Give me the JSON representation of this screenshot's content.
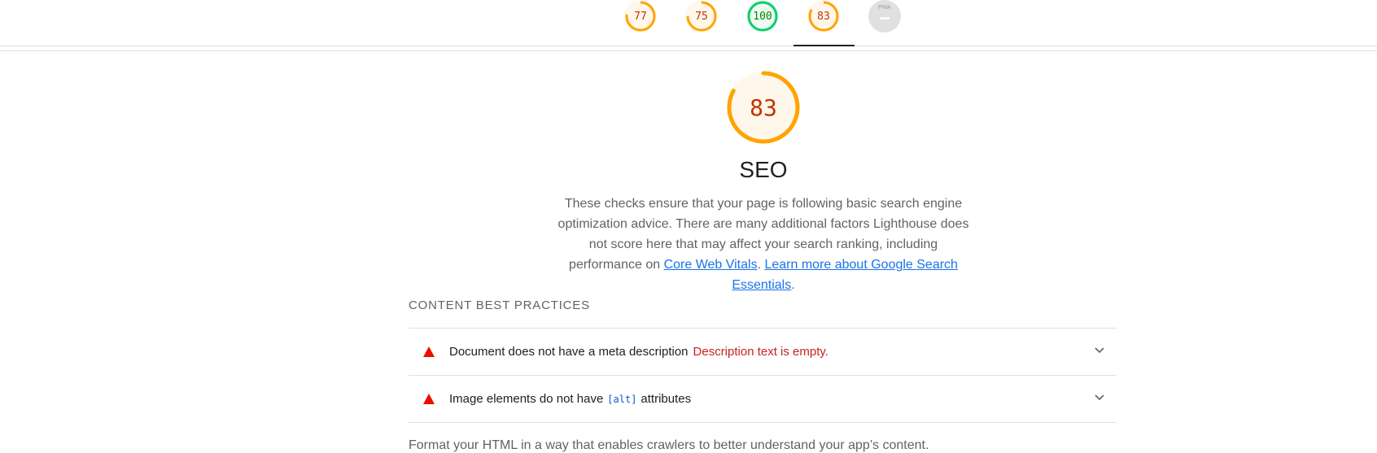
{
  "tabs": [
    {
      "score": "77",
      "category": "performance"
    },
    {
      "score": "75",
      "category": "accessibility"
    },
    {
      "score": "100",
      "category": "best-practices"
    },
    {
      "score": "83",
      "category": "seo",
      "active": true
    },
    {
      "score": "",
      "category": "pwa",
      "badge_text": "PWA"
    }
  ],
  "colors": {
    "average": "#ffa400",
    "average_text": "#c33300",
    "pass": "#0cce6b",
    "pass_text": "#008800",
    "fail": "#eb0f00",
    "link": "#1a73e8"
  },
  "category": {
    "score": "83",
    "title": "SEO",
    "description_text": "These checks ensure that your page is following basic search engine optimization advice. There are many additional factors Lighthouse does not score here that may affect your search ranking, including performance on ",
    "link1": "Core Web Vitals",
    "sep": ". ",
    "link2": "Learn more about Google Search Essentials",
    "end": "."
  },
  "section": {
    "title": "CONTENT BEST PRACTICES",
    "audits": [
      {
        "title": "Document does not have a meta description",
        "display_value": "Description text is empty."
      },
      {
        "title_before": "Image elements do not have",
        "code": "[alt]",
        "title_after": "attributes"
      }
    ],
    "footer": "Format your HTML in a way that enables crawlers to better understand your app’s content."
  }
}
